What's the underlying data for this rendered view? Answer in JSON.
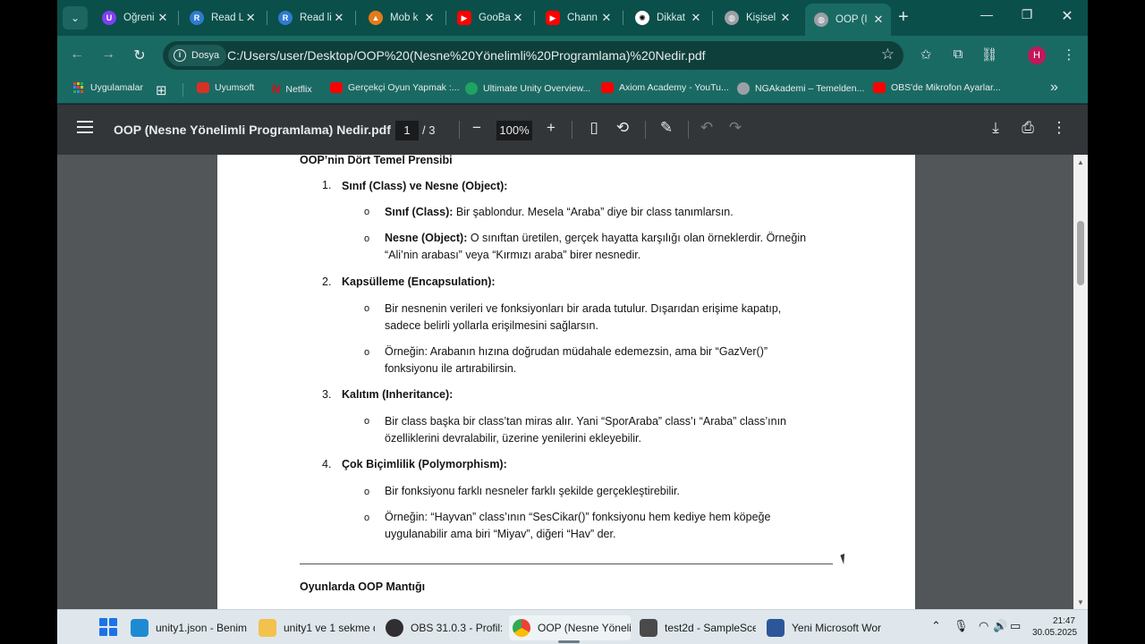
{
  "browser": {
    "tabs": [
      {
        "label": "Öğreni",
        "icon": "udemy-icon",
        "color": "#7e3ff2"
      },
      {
        "label": "Read L",
        "icon": "reader-icon",
        "color": "#2e7bcf"
      },
      {
        "label": "Read li",
        "icon": "reader-icon",
        "color": "#2e7bcf"
      },
      {
        "label": "Mob k",
        "icon": "game-icon",
        "color": "#e37b1a"
      },
      {
        "label": "GooBa",
        "icon": "youtube-icon",
        "color": "#ff0000"
      },
      {
        "label": "Chann",
        "icon": "youtube-icon",
        "color": "#ff0000"
      },
      {
        "label": "Dikkat",
        "icon": "openai-icon",
        "color": "#ffffff"
      },
      {
        "label": "Kişisel",
        "icon": "globe-icon",
        "color": "#9aa0a6"
      },
      {
        "label": "OOP (I",
        "icon": "globe-icon",
        "color": "#9aa0a6"
      }
    ],
    "address": {
      "chip_label": "Dosya",
      "url": "C:/Users/user/Desktop/OOP%20(Nesne%20Yönelimli%20Programlama)%20Nedir.pdf"
    },
    "profile_initial": "H",
    "bookmarks": [
      {
        "label": "Uygulamalar",
        "color": "#f4b400"
      },
      {
        "label": "Uyumsoft",
        "color": "#d93025"
      },
      {
        "label": "Netflix",
        "color": "#e50914"
      },
      {
        "label": "Gerçekçi Oyun Yapmak :...",
        "color": "#ff0000"
      },
      {
        "label": "Ultimate Unity Overview...",
        "color": "#1ea362"
      },
      {
        "label": "Axiom Academy - YouTu...",
        "color": "#ff0000"
      },
      {
        "label": "NGAkademi – Temelden...",
        "color": "#9aa0a6"
      },
      {
        "label": "OBS'de Mikrofon Ayarlar...",
        "color": "#ff0000"
      }
    ]
  },
  "pdf": {
    "title": "OOP (Nesne Yönelimli Programlama) Nedir.pdf",
    "current_page": "1",
    "total_pages": "/  3",
    "zoom": "100%"
  },
  "document": {
    "section_title": "OOP’nin Dört Temel Prensibi",
    "items": [
      {
        "number": "1.",
        "heading": "Sınıf (Class) ve Nesne (Object):",
        "bullets": [
          {
            "bold": "Sınıf (Class):",
            "lines": [
              " Bir şablondur. Mesela “Araba” diye bir class tanımlarsın."
            ]
          },
          {
            "bold": "Nesne (Object):",
            "lines": [
              " O sınıftan üretilen, gerçek hayatta karşılığı olan örneklerdir. Örneğin",
              "“Ali’nin arabası” veya “Kırmızı araba” birer nesnedir."
            ]
          }
        ]
      },
      {
        "number": "2.",
        "heading": "Kapsülleme (Encapsulation):",
        "bullets": [
          {
            "bold": "",
            "lines": [
              "Bir nesnenin verileri ve fonksiyonları bir arada tutulur. Dışarıdan erişime kapatıp,",
              "sadece belirli yollarla erişilmesini sağlarsın."
            ]
          },
          {
            "bold": "",
            "lines": [
              "Örneğin: Arabanın hızına doğrudan müdahale edemezsin, ama bir “GazVer()”",
              "fonksiyonu ile artırabilirsin."
            ]
          }
        ]
      },
      {
        "number": "3.",
        "heading": "Kalıtım (Inheritance):",
        "bullets": [
          {
            "bold": "",
            "lines": [
              "Bir class başka bir class’tan miras alır. Yani “SporAraba” class’ı “Araba” class’ının",
              "özelliklerini devralabilir, üzerine yenilerini ekleyebilir."
            ]
          }
        ]
      },
      {
        "number": "4.",
        "heading": "Çok Biçimlilik (Polymorphism):",
        "bullets": [
          {
            "bold": "",
            "lines": [
              "Bir fonksiyonu farklı nesneler farklı şekilde gerçekleştirebilir."
            ]
          },
          {
            "bold": "",
            "lines": [
              "Örneğin: “Hayvan” class’ının “SesCikar()” fonksiyonu hem kediye hem köpeğe",
              "uygulanabilir ama biri “Miyav”, diğeri “Hav” der."
            ]
          }
        ]
      }
    ],
    "next_section_title": "Oyunlarda OOP Mantığı",
    "bullet_glyph": "o"
  },
  "taskbar": {
    "apps": [
      {
        "label": "unity1.json - Benim:",
        "icon": "vscode-icon",
        "color": "#1f8ad2"
      },
      {
        "label": "unity1 ve 1 sekme d",
        "icon": "folder-icon",
        "color": "#f2c14e"
      },
      {
        "label": "OBS 31.0.3 - Profil: İ",
        "icon": "obs-icon",
        "color": "#302e31"
      },
      {
        "label": "OOP (Nesne Yönelii",
        "icon": "chrome-icon",
        "color": "#34a853"
      },
      {
        "label": "test2d - SampleSce",
        "icon": "unity-icon",
        "color": "#4a4a4a"
      },
      {
        "label": "Yeni Microsoft Wor",
        "icon": "word-icon",
        "color": "#2b579a"
      }
    ],
    "time": "21:47",
    "date": "30.05.2025"
  }
}
